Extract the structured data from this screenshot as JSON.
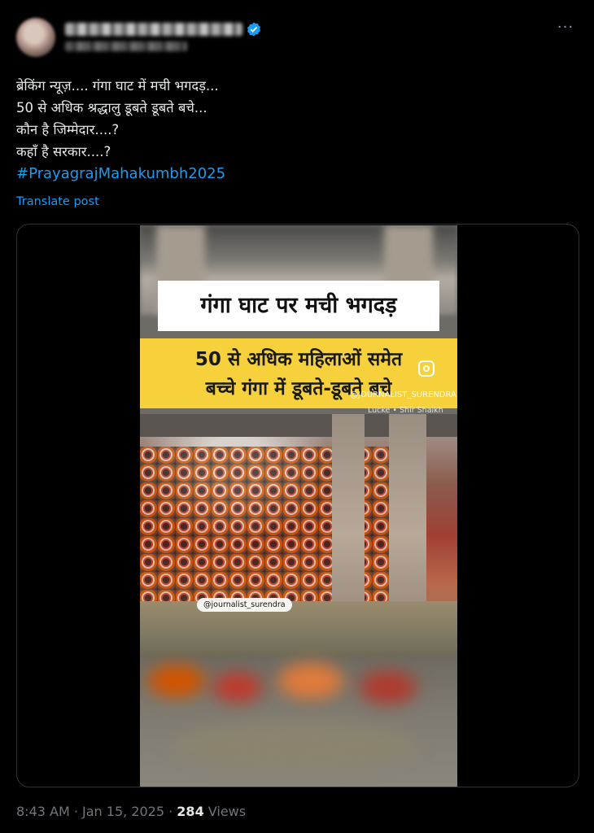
{
  "tweet": {
    "lines": [
      "ब्रेकिंग न्यूज़.... गंगा घाट में मची भगदड़...",
      " 50 से अधिक श्रद्धालु डूबते डूबते बचे...",
      "कौन है जिम्मेदार....?",
      "कहाँ है सरकार....?"
    ],
    "hashtag": "#PrayagrajMahakumbh2025",
    "translate_label": "Translate post",
    "more_icon": "more-icon"
  },
  "video": {
    "title": "गंगा घाट पर मची भगदड़",
    "subtitle_line1": "50 से अधिक महिलाओं समेत",
    "subtitle_line2": "बच्चे गंगा में डूबते-डूबते बचे",
    "watermark": "@JOURNALIST_SURENDRA",
    "credit": "Lucke • Shir Shaikh",
    "tag": "@journalist_surendra"
  },
  "footer": {
    "time": "8:43 AM",
    "sep": " · ",
    "date": "Jan 15, 2025",
    "sep2": " · ",
    "views_count": "284",
    "views_label": " Views"
  },
  "colors": {
    "accent": "#1d9bf0",
    "background": "#000000",
    "banner_yellow": "#f7d13b"
  }
}
